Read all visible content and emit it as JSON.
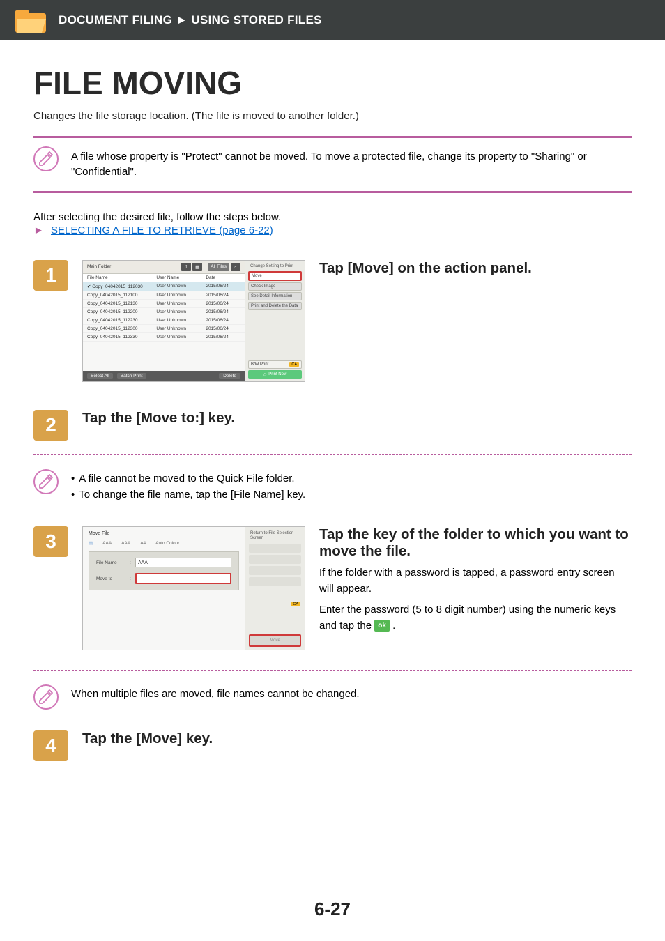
{
  "header": {
    "breadcrumb_a": "DOCUMENT FILING",
    "breadcrumb_sep": "►",
    "breadcrumb_b": "USING STORED FILES"
  },
  "title": "FILE MOVING",
  "subtitle": "Changes the file storage location. (The file is moved to another folder.)",
  "note1": "A file whose property is \"Protect\" cannot be moved. To move a protected file, change its property to \"Sharing\" or \"Confidential\".",
  "after_selecting": "After selecting the desired file, follow the steps below.",
  "link_text": "SELECTING A FILE TO RETRIEVE (page 6-22)",
  "steps": {
    "s1": {
      "num": "1",
      "heading": "Tap [Move] on the action panel."
    },
    "s2": {
      "num": "2",
      "heading": "Tap the [Move to:] key."
    },
    "s3": {
      "num": "3",
      "heading": "Tap the key of the folder to which you want to move the file.",
      "body1": "If the folder with a password is tapped, a password entry screen will appear.",
      "body2a": "Enter the password (5 to 8 digit number) using the numeric keys and tap the ",
      "body2b": "."
    },
    "s4": {
      "num": "4",
      "heading": "Tap the [Move] key."
    }
  },
  "notes2": {
    "b1": "A file cannot be moved to the Quick File folder.",
    "b2": "To change the file name, tap the [File Name] key."
  },
  "note3": "When multiple files are moved, file names cannot be changed.",
  "ok_label": "ok",
  "shot1": {
    "title": "Main Folder",
    "all_files": "All Files",
    "cols": {
      "file": "File Name",
      "user": "User Name",
      "date": "Date"
    },
    "rows": [
      {
        "f": "Copy_04042015_112030",
        "u": "User Unknown",
        "d": "2015/06/24",
        "sel": true
      },
      {
        "f": "Copy_04042015_112100",
        "u": "User Unknown",
        "d": "2015/06/24",
        "sel": false
      },
      {
        "f": "Copy_04042015_112130",
        "u": "User Unknown",
        "d": "2015/06/24",
        "sel": false
      },
      {
        "f": "Copy_04042015_112200",
        "u": "User Unknown",
        "d": "2015/06/24",
        "sel": false
      },
      {
        "f": "Copy_04042015_112230",
        "u": "User Unknown",
        "d": "2015/06/24",
        "sel": false
      },
      {
        "f": "Copy_04042015_112300",
        "u": "User Unknown",
        "d": "2015/06/24",
        "sel": false
      },
      {
        "f": "Copy_04042015_112330",
        "u": "User Unknown",
        "d": "2015/06/24",
        "sel": false
      }
    ],
    "select_all": "Select All",
    "batch_print": "Batch Print",
    "delete": "Delete",
    "side": {
      "change": "Change Setting to Print",
      "move": "Move",
      "check": "Check Image",
      "detail": "See Detail Information",
      "printdel": "Print and Delete the Data",
      "bw": "B/W Print",
      "ca": "CA",
      "print_now": "Print Now"
    }
  },
  "shot3": {
    "title": "Move File",
    "tabs": {
      "a": "AAA",
      "b": "AAA",
      "c": "A4",
      "d": "Auto Colour"
    },
    "file_name_label": "File Name",
    "file_name_value": "AAA",
    "move_to_label": "Move to",
    "return": "Return to File Selection Screen",
    "ca": "CA",
    "move": "Move"
  },
  "page_number": "6-27"
}
